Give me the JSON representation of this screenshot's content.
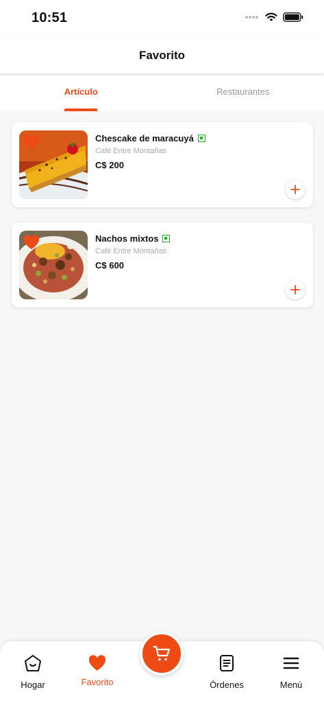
{
  "status": {
    "time": "10:51"
  },
  "header": {
    "title": "Favorito"
  },
  "tabs": [
    {
      "label": "Artículo",
      "active": true
    },
    {
      "label": "Restaurantes",
      "active": false
    }
  ],
  "favorites": [
    {
      "name": "Chescake de maracuyá",
      "restaurant": "Café Entre Montañas",
      "price": "C$ 200",
      "image": "cheesecake-photo"
    },
    {
      "name": "Nachos mixtos",
      "restaurant": "Café Entre Montañas",
      "price": "C$ 600",
      "image": "nachos-photo"
    }
  ],
  "bottom_nav": {
    "home": {
      "label": "Hogar",
      "icon": "home-icon"
    },
    "favorite": {
      "label": "Favorito",
      "icon": "heart-icon"
    },
    "cart": {
      "icon": "cart-icon"
    },
    "orders": {
      "label": "Órdenes",
      "icon": "document-icon"
    },
    "menu": {
      "label": "Menú",
      "icon": "hamburger-icon"
    }
  },
  "colors": {
    "accent": "#f04a14",
    "veg": "#1db31d"
  }
}
